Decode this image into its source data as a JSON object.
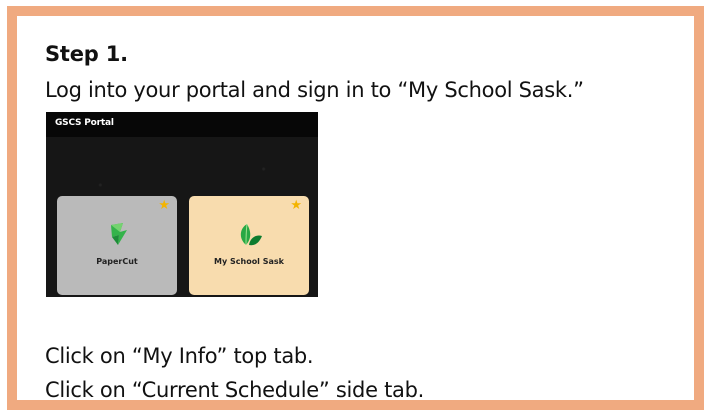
{
  "step": {
    "title": "Step 1.",
    "instruction": "Log into your portal and sign in to “My School Sask.”",
    "follow_up_1": "Click on “My Info” top tab.",
    "follow_up_2": "Click on “Current Schedule” side tab."
  },
  "portal": {
    "title": "GSCS Portal",
    "tiles": [
      {
        "label": "PaperCut",
        "icon": "papercut-icon",
        "starred": true
      },
      {
        "label": "My School Sask",
        "icon": "my-school-sask-icon",
        "starred": true
      }
    ]
  },
  "colors": {
    "frame_border": "#f0aa80",
    "portal_background": "#161616",
    "papercut_tile": "#bababa",
    "my_school_sask_tile": "#f8dcae",
    "star": "#f4b400"
  }
}
